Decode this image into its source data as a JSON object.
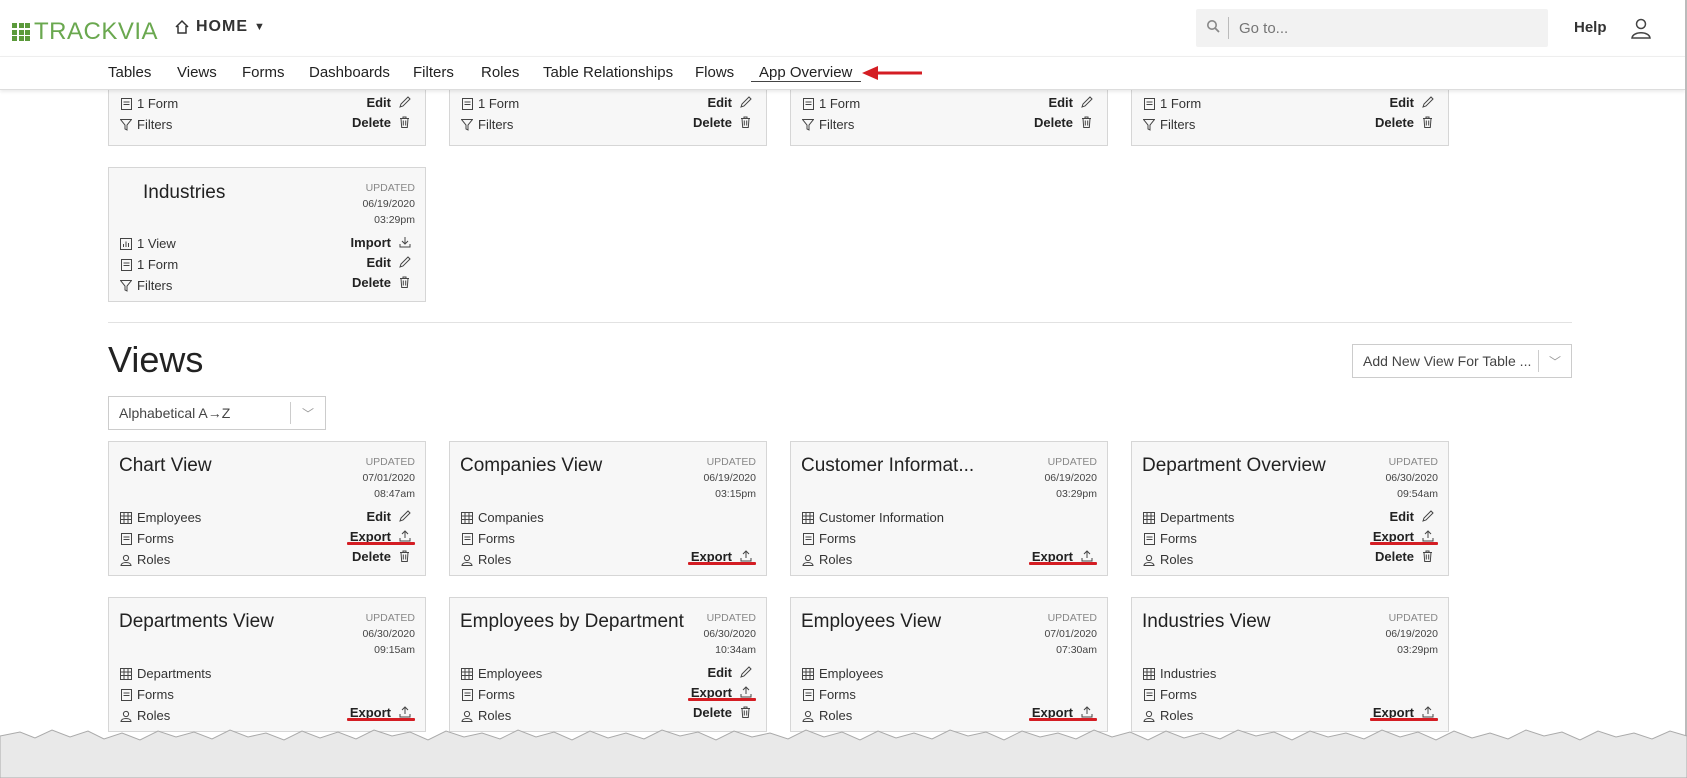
{
  "topbar": {
    "logo_text": "TRACKVIA",
    "home_label": "HOME",
    "search_placeholder": "Go to...",
    "help_label": "Help"
  },
  "nav": {
    "items": [
      "Tables",
      "Views",
      "Forms",
      "Dashboards",
      "Filters",
      "Roles",
      "Table Relationships",
      "Flows",
      "App Overview"
    ]
  },
  "tables_partial": [
    {
      "form": "1 Form",
      "filters": "Filters",
      "edit": "Edit",
      "delete": "Delete"
    },
    {
      "form": "1 Form",
      "filters": "Filters",
      "edit": "Edit",
      "delete": "Delete"
    },
    {
      "form": "1 Form",
      "filters": "Filters",
      "edit": "Edit",
      "delete": "Delete"
    },
    {
      "form": "1 Form",
      "filters": "Filters",
      "edit": "Edit",
      "delete": "Delete"
    }
  ],
  "industries_table": {
    "title": "Industries",
    "updated_label": "UPDATED",
    "date": "06/19/2020",
    "time": "03:29pm",
    "view": "1 View",
    "form": "1 Form",
    "filters": "Filters",
    "import": "Import",
    "edit": "Edit",
    "delete": "Delete"
  },
  "views_section": {
    "title": "Views",
    "sort_label": "Alphabetical A→Z",
    "add_label": "Add New View For Table ..."
  },
  "views": [
    {
      "title": "Chart View",
      "updated_label": "UPDATED",
      "date": "07/01/2020",
      "time": "08:47am",
      "table": "Employees",
      "forms": "Forms",
      "roles": "Roles",
      "edit": "Edit",
      "export": "Export",
      "delete": "Delete"
    },
    {
      "title": "Companies View",
      "updated_label": "UPDATED",
      "date": "06/19/2020",
      "time": "03:15pm",
      "table": "Companies",
      "forms": "Forms",
      "roles": "Roles",
      "export": "Export"
    },
    {
      "title": "Customer Informat...",
      "updated_label": "UPDATED",
      "date": "06/19/2020",
      "time": "03:29pm",
      "table": "Customer Information",
      "forms": "Forms",
      "roles": "Roles",
      "export": "Export"
    },
    {
      "title": "Department Overview",
      "updated_label": "UPDATED",
      "date": "06/30/2020",
      "time": "09:54am",
      "table": "Departments",
      "forms": "Forms",
      "roles": "Roles",
      "edit": "Edit",
      "export": "Export",
      "delete": "Delete"
    },
    {
      "title": "Departments View",
      "updated_label": "UPDATED",
      "date": "06/30/2020",
      "time": "09:15am",
      "table": "Departments",
      "forms": "Forms",
      "roles": "Roles",
      "export": "Export"
    },
    {
      "title": "Employees by Department",
      "updated_label": "UPDATED",
      "date": "06/30/2020",
      "time": "10:34am",
      "table": "Employees",
      "forms": "Forms",
      "roles": "Roles",
      "edit": "Edit",
      "export": "Export",
      "delete": "Delete"
    },
    {
      "title": "Employees View",
      "updated_label": "UPDATED",
      "date": "07/01/2020",
      "time": "07:30am",
      "table": "Employees",
      "forms": "Forms",
      "roles": "Roles",
      "export": "Export"
    },
    {
      "title": "Industries View",
      "updated_label": "UPDATED",
      "date": "06/19/2020",
      "time": "03:29pm",
      "table": "Industries",
      "forms": "Forms",
      "roles": "Roles",
      "export": "Export"
    }
  ],
  "colors": {
    "brand_green": "#6aa84f",
    "annotation_red": "#d41d23",
    "card_bg": "#f7f7f7"
  }
}
